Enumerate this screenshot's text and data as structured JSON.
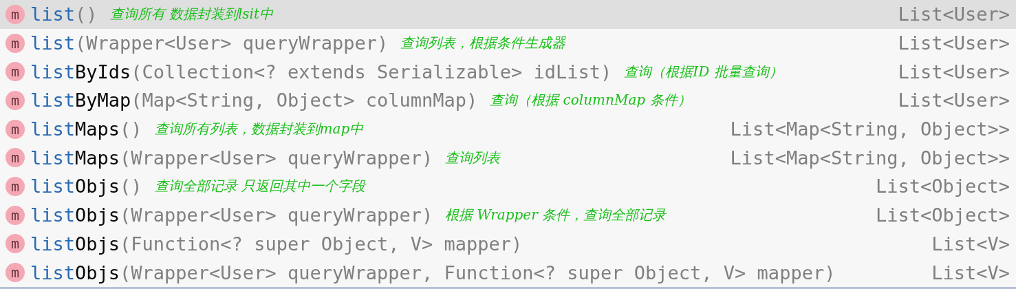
{
  "completion_items": [
    {
      "icon": "m",
      "prefix": "list",
      "params": "()",
      "note": "查询所有 数据封装到lsit中",
      "return_type": "List<User>",
      "selected": true
    },
    {
      "icon": "m",
      "prefix": "list",
      "params": "(Wrapper<User> queryWrapper)",
      "note": "查询列表，根据条件生成器",
      "return_type": "List<User>",
      "selected": false
    },
    {
      "icon": "m",
      "prefix": "list",
      "name_rest": "ByIds",
      "params": "(Collection<? extends Serializable> idList)",
      "note": "查询（根据ID 批量查询）",
      "return_type": "List<User>",
      "selected": false
    },
    {
      "icon": "m",
      "prefix": "list",
      "name_rest": "ByMap",
      "params": "(Map<String, Object> columnMap)",
      "note": "查询（根据 columnMap 条件）",
      "return_type": "List<User>",
      "selected": false
    },
    {
      "icon": "m",
      "prefix": "list",
      "name_rest": "Maps",
      "params": "()",
      "note": "查询所有列表，数据封装到map中",
      "return_type": "List<Map<String, Object>>",
      "selected": false
    },
    {
      "icon": "m",
      "prefix": "list",
      "name_rest": "Maps",
      "params": "(Wrapper<User> queryWrapper)",
      "note": "查询列表",
      "return_type": "List<Map<String, Object>>",
      "selected": false
    },
    {
      "icon": "m",
      "prefix": "list",
      "name_rest": "Objs",
      "params": "()",
      "note": "查询全部记录 只返回其中一个字段",
      "return_type": "List<Object>",
      "selected": false
    },
    {
      "icon": "m",
      "prefix": "list",
      "name_rest": "Objs",
      "params": "(Wrapper<User> queryWrapper)",
      "note": "根据 Wrapper 条件，查询全部记录",
      "return_type": "List<Object>",
      "selected": false
    },
    {
      "icon": "m",
      "prefix": "list",
      "name_rest": "Objs",
      "params": "(Function<? super Object, V> mapper)",
      "return_type": "List<V>",
      "selected": false
    },
    {
      "icon": "m",
      "prefix": "list",
      "name_rest": "Objs",
      "params": "(Wrapper<User> queryWrapper, Function<? super Object, V> mapper)",
      "return_type": "List<V>",
      "selected": false
    }
  ]
}
